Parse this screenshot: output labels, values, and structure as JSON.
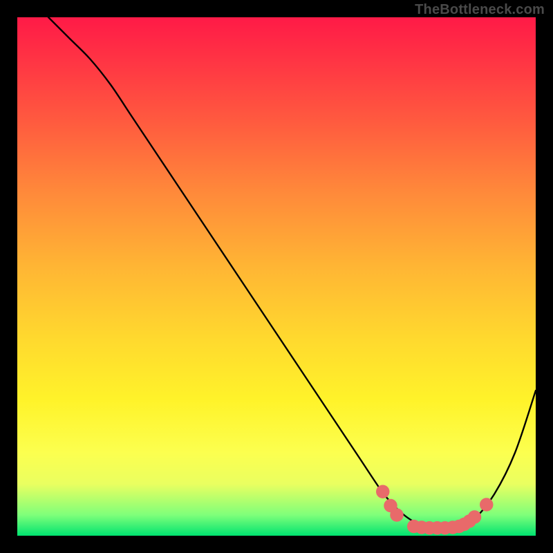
{
  "watermark": "TheBottleneck.com",
  "chart_data": {
    "type": "line",
    "title": "",
    "xlabel": "",
    "ylabel": "",
    "xlim": [
      0,
      100
    ],
    "ylim": [
      0,
      100
    ],
    "grid": false,
    "legend": false,
    "series": [
      {
        "name": "curve",
        "color": "#000000",
        "x": [
          6,
          10,
          14,
          18,
          22,
          26,
          30,
          34,
          38,
          42,
          46,
          50,
          54,
          58,
          62,
          66,
          70,
          72,
          74,
          76,
          78,
          80,
          82,
          84,
          86,
          88,
          92,
          96,
          100
        ],
        "y": [
          100,
          96,
          92,
          87,
          81,
          75,
          69,
          63,
          57,
          51,
          45,
          39,
          33,
          27,
          21,
          15,
          9,
          6.5,
          4.5,
          3,
          2,
          1.5,
          1.5,
          1.5,
          2,
          3,
          8,
          16,
          28
        ]
      }
    ],
    "markers": [
      {
        "x": 70.5,
        "y": 8.5
      },
      {
        "x": 72.0,
        "y": 5.8
      },
      {
        "x": 73.2,
        "y": 4.0
      },
      {
        "x": 76.5,
        "y": 1.8
      },
      {
        "x": 78.0,
        "y": 1.6
      },
      {
        "x": 79.5,
        "y": 1.5
      },
      {
        "x": 81.0,
        "y": 1.5
      },
      {
        "x": 82.5,
        "y": 1.5
      },
      {
        "x": 84.0,
        "y": 1.6
      },
      {
        "x": 85.2,
        "y": 1.8
      },
      {
        "x": 86.2,
        "y": 2.2
      },
      {
        "x": 87.2,
        "y": 2.8
      },
      {
        "x": 88.2,
        "y": 3.6
      },
      {
        "x": 90.5,
        "y": 6.0
      }
    ],
    "marker_color": "#e86a6a",
    "marker_radius_pct": 1.3
  }
}
